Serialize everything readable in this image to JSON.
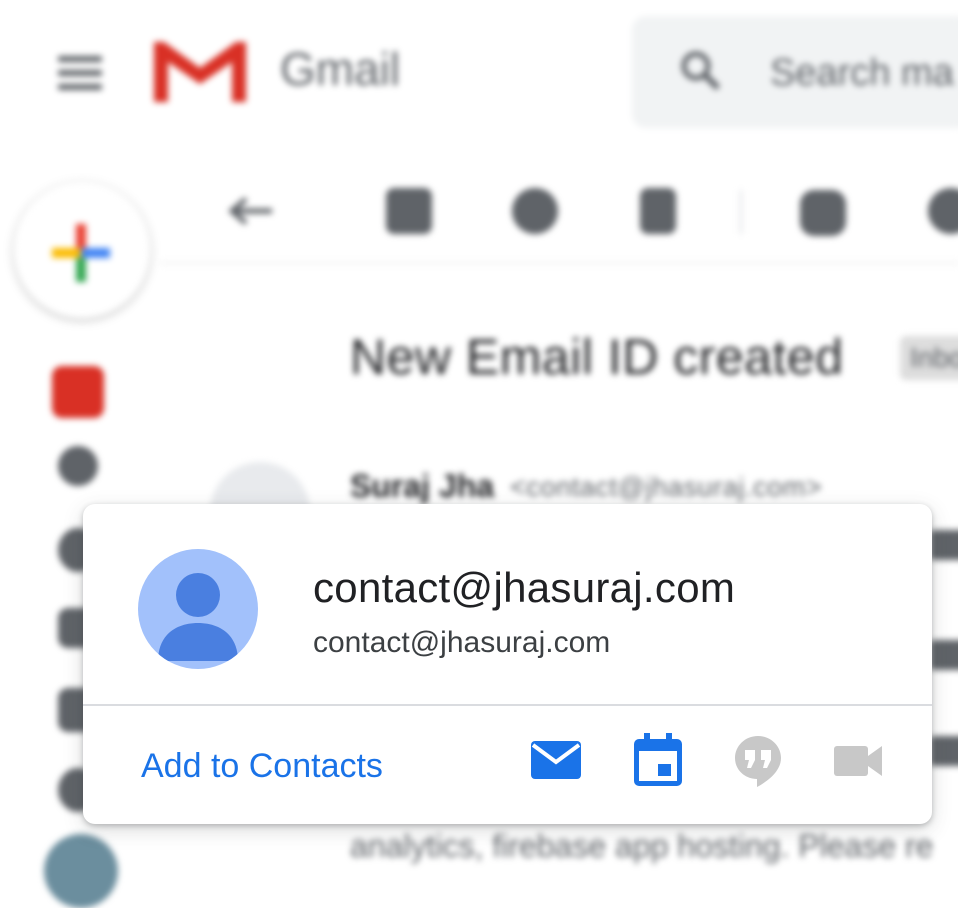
{
  "background": {
    "app_name": "Gmail",
    "search_placeholder": "Search ma",
    "email": {
      "subject": "New Email ID created",
      "label_chip": "Inbo",
      "sender_name": "Suraj Jha",
      "sender_email": "<contact@jhasuraj.com>",
      "body_snippet": "analytics, firebase app hosting. Please re"
    }
  },
  "hover_card": {
    "display_name": "contact@jhasuraj.com",
    "email": "contact@jhasuraj.com",
    "add_to_contacts_label": "Add to Contacts",
    "actions": [
      {
        "icon": "mail-icon",
        "enabled": true
      },
      {
        "icon": "calendar-icon",
        "enabled": true
      },
      {
        "icon": "hangouts-icon",
        "enabled": false
      },
      {
        "icon": "video-call-icon",
        "enabled": false
      }
    ]
  },
  "colors": {
    "accent_blue": "#1a73e8",
    "avatar_bg": "#a2c1fb",
    "avatar_fg": "#4a7fe0",
    "disabled_icon": "#c8c8c8",
    "gmail_red": "#d93025"
  }
}
